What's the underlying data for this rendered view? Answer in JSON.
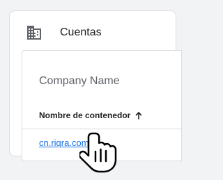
{
  "card": {
    "title": "Cuentas",
    "icon": "building-icon"
  },
  "account": {
    "name_placeholder": "Company Name"
  },
  "table": {
    "column_header": "Nombre de contenedor",
    "sort_icon": "arrow-up-icon",
    "rows": [
      {
        "container_name": "cn.riqra.com"
      }
    ]
  },
  "cursor": {
    "icon": "hand-pointer-icon"
  },
  "colors": {
    "page_bg": "#f1f3f4",
    "card_bg": "#ffffff",
    "border": "#dadce0",
    "link": "#1a73e8",
    "text_primary": "#202124",
    "text_secondary": "#5f6368"
  }
}
